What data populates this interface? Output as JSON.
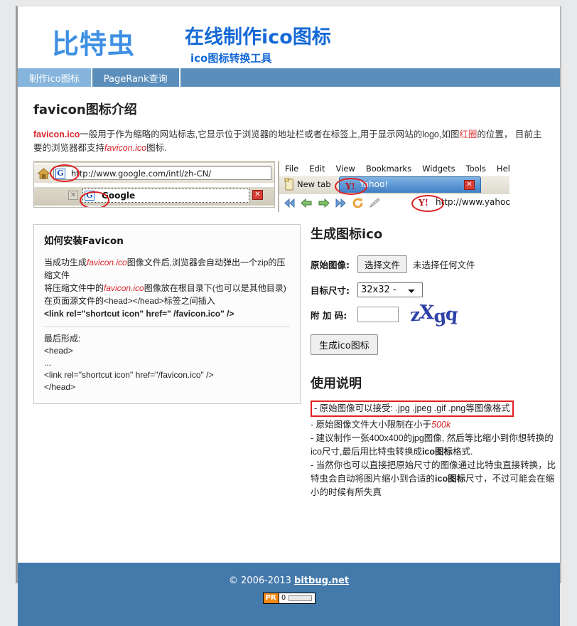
{
  "header": {
    "logo": "比特虫",
    "title": "在线制作ico图标",
    "subtitle": "ico图标转换工具"
  },
  "nav": {
    "items": [
      {
        "label": "制作ico图标",
        "active": true
      },
      {
        "label": "PageRank查询",
        "active": false
      }
    ]
  },
  "intro": {
    "heading": "favicon图标介绍",
    "lead": "favicon.ico",
    "body_1": "一般用于作为缩略的网站标志,它显示位于浏览器的地址栏或者在标签上,用于显示网站的logo,如图",
    "highlight": "红圈",
    "body_2": "的位置， 目前主要的浏览器都支持",
    "italic": "favicon.ico",
    "body_3": "图标."
  },
  "screenshots": {
    "google": {
      "url": "http://www.google.com/intl/zh-CN/",
      "favicon_letter": "G",
      "tab_title": "Google",
      "tab_close": "✕",
      "tab_prev_close": "✕"
    },
    "opera": {
      "menu": [
        "File",
        "Edit",
        "View",
        "Bookmarks",
        "Widgets",
        "Tools",
        "Help"
      ],
      "new_tab": "New tab",
      "tab_title": "Yahoo!",
      "tab_favicon": "Y!",
      "tab_close": "✕",
      "url": "http://www.yahoo.com",
      "url_favicon": "Y!"
    }
  },
  "install": {
    "heading": "如何安装Favicon",
    "line1_a": "当成功生成",
    "line1_i": "favicon.ico",
    "line1_b": "图像文件后,浏览器会自动弹出一个zip的压缩文件",
    "line2_a": "将压缩文件中的",
    "line2_i": "favicon.ico",
    "line2_b": "图像放在根目录下(也可以是其他目录)",
    "line3": "在页面源文件的<head></head>标签之间插入",
    "line4": "<link rel=\"shortcut icon\" href=\" /favicon.ico\" />",
    "after_label": "最后形成:",
    "code_1": "<head>",
    "code_2": "...",
    "code_3": "<link rel=\"shortcut icon\" href=\"/favicon.ico\" />",
    "code_4": "</head>"
  },
  "form": {
    "title": "生成图标ico",
    "source_label": "原始图像:",
    "file_button": "选择文件",
    "file_status": "未选择任何文件",
    "size_label": "目标尺寸:",
    "size_value": "32x32 -",
    "size_options": [
      "32x32 -"
    ],
    "code_label": "附 加 码:",
    "code_value": "",
    "captcha": "zXgq",
    "captcha_chars": [
      "z",
      "X",
      "g",
      "q"
    ],
    "submit": "生成ico图标"
  },
  "usage": {
    "title": "使用说明",
    "item1": "- 原始图像可以接受: .jpg .jpeg .gif .png等图像格式",
    "item2_a": "- 原始图像文件大小限制在小于",
    "item2_red": "500k",
    "item3_a": "- 建议制作一张400x400的jpg图像, 然后等比缩小到你想转换的ico尺寸,最后用比特虫转换成",
    "item3_b": "ico图标",
    "item3_c": "格式.",
    "item4_a": "- 当然你也可以直接把原始尺寸的图像通过比特虫直接转换，比特虫会自动将图片缩小到合适的",
    "item4_b": "ico图标",
    "item4_c": "尺寸，不过可能会在缩小的时候有所失真"
  },
  "footer": {
    "copyright": "© 2006-2013",
    "site": "bitbug.net",
    "pr_tag": "PR",
    "pr_value": "0"
  },
  "colors": {
    "brand_blue": "#1469d6",
    "logo_blue": "#3d90e3",
    "nav_blue": "#5b8ebb",
    "nav_active": "#85b4dc",
    "footer_blue": "#4479ab",
    "accent_red": "#d8262c",
    "pr_orange": "#f28a17"
  }
}
